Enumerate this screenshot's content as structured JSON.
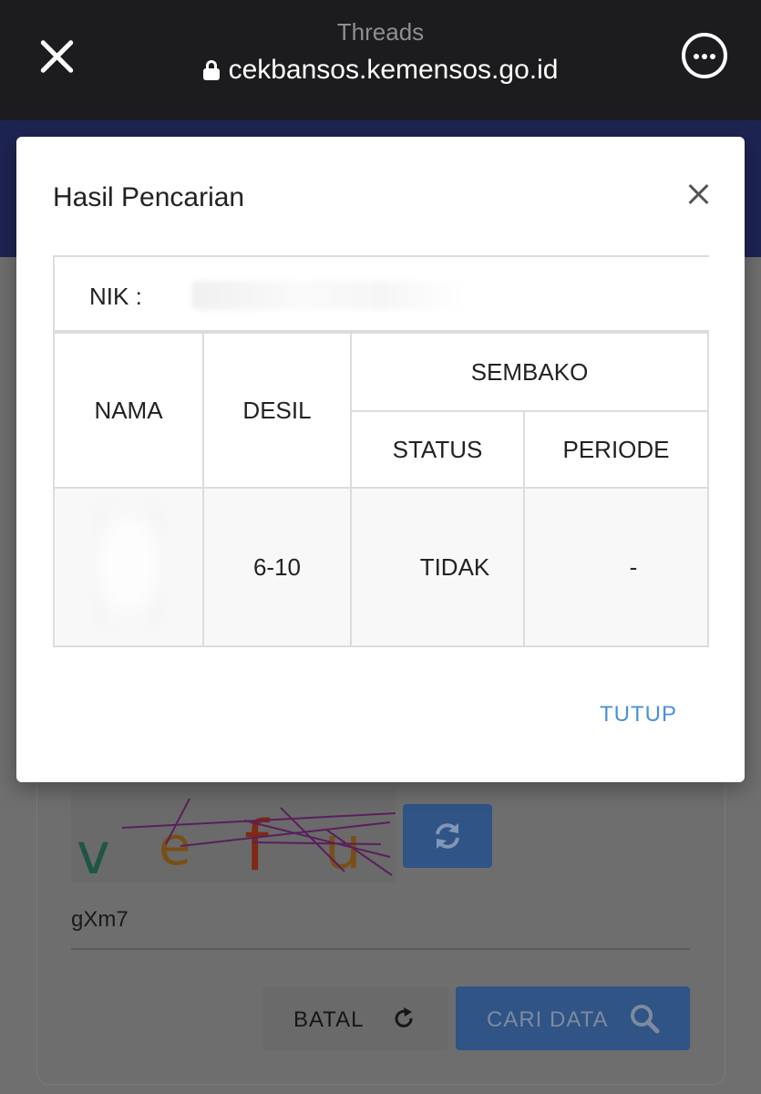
{
  "browser": {
    "app_title": "Threads",
    "url": "cekbansos.kemensos.go.id"
  },
  "modal": {
    "title": "Hasil Pencarian",
    "nik_label": "NIK :",
    "nik_value": "",
    "table": {
      "headers": {
        "nama": "NAMA",
        "desil": "DESIL",
        "program": "SEMBAKO",
        "status": "STATUS",
        "periode": "PERIODE"
      },
      "rows": [
        {
          "nama": "",
          "desil": "6-10",
          "status": "TIDAK",
          "periode": "-"
        }
      ]
    },
    "close_label": "TUTUP"
  },
  "form": {
    "captcha_input_value": "gXm7",
    "batal_label": "BATAL",
    "cari_label": "CARI DATA"
  },
  "icons": {
    "close": "close-icon",
    "more": "more-icon",
    "lock": "lock-icon",
    "refresh": "refresh-icon",
    "search": "search-icon"
  },
  "colors": {
    "link_accent": "#4a90d9",
    "primary_button": "#2f5485",
    "browser_bar": "#1c1c1e"
  }
}
